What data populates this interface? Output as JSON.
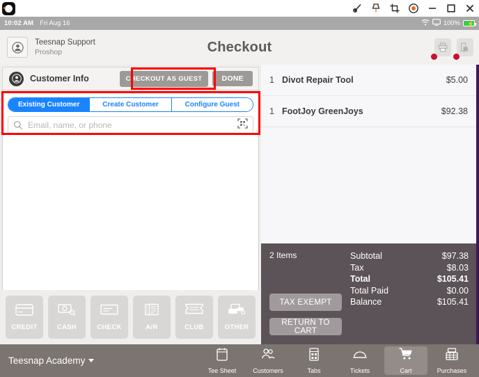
{
  "window": {
    "app_icon": "camera-app-icon",
    "tools": [
      {
        "name": "brush-icon",
        "label": "Brush"
      },
      {
        "name": "pin-icon",
        "label": "Pin"
      },
      {
        "name": "crop-icon",
        "label": "Crop"
      },
      {
        "name": "record-icon",
        "label": "Record"
      },
      {
        "name": "minimize-icon",
        "label": "Minimize"
      },
      {
        "name": "maximize-icon",
        "label": "Maximize"
      },
      {
        "name": "close-icon",
        "label": "Close"
      }
    ]
  },
  "statusbar": {
    "time": "10:02 AM",
    "date": "Fri Aug 16",
    "wifi_icon": "wifi-icon",
    "airplay_icon": "display-icon",
    "battery_percent": "100%",
    "battery_color": "#35cd4b"
  },
  "header": {
    "user_name": "Teesnap Support",
    "user_role": "Proshop",
    "title": "Checkout",
    "actions": [
      {
        "name": "printer-button",
        "icon": "printer-icon",
        "badge": true
      },
      {
        "name": "cash-drawer-button",
        "icon": "cash-drawer-icon",
        "badge": true
      }
    ],
    "badge_color": "#c9102c"
  },
  "customer_info": {
    "title": "Customer Info",
    "avatar_icon": "person-circle-icon",
    "checkout_as_guest_label": "CHECKOUT AS GUEST",
    "done_label": "DONE",
    "tabs": [
      {
        "label": "Existing Customer",
        "active": true
      },
      {
        "label": "Create Customer",
        "active": false
      },
      {
        "label": "Configure Guest",
        "active": false
      }
    ],
    "accent_color": "#1a84ff",
    "search": {
      "placeholder": "Email, name, or phone",
      "value": "",
      "left_icon": "search-icon",
      "right_icon": "qr-scan-icon"
    }
  },
  "annotations": {
    "color": "#fe0000",
    "boxes": [
      {
        "name": "annotation-checkout-as-guest"
      },
      {
        "name": "annotation-customer-search"
      }
    ]
  },
  "payment_methods": [
    {
      "label": "CREDIT",
      "icon": "credit-card-icon"
    },
    {
      "label": "CASH",
      "icon": "cash-icon"
    },
    {
      "label": "CHECK",
      "icon": "check-icon"
    },
    {
      "label": "A/R",
      "icon": "receipt-icon"
    },
    {
      "label": "CLUB",
      "icon": "club-ticket-icon"
    },
    {
      "label": "OTHER",
      "icon": "other-icon"
    }
  ],
  "cart": {
    "items": [
      {
        "qty": "1",
        "name": "Divot Repair Tool",
        "price": "$5.00"
      },
      {
        "qty": "1",
        "name": "FootJoy GreenJoys",
        "price": "$92.38"
      }
    ],
    "items_count_label": "2 Items",
    "totals": [
      {
        "label": "Subtotal",
        "value": "$97.38",
        "bold": false
      },
      {
        "label": "Tax",
        "value": "$8.03",
        "bold": false
      },
      {
        "label": "Total",
        "value": "$105.41",
        "bold": true
      },
      {
        "label": "Total Paid",
        "value": "$0.00",
        "bold": false
      },
      {
        "label": "Balance",
        "value": "$105.41",
        "bold": false
      }
    ],
    "tax_exempt_label": "TAX EXEMPT",
    "return_to_cart_label": "RETURN TO CART"
  },
  "bottom_nav": {
    "account_label": "Teesnap Academy",
    "items": [
      {
        "label": "Tee Sheet",
        "icon": "tee-sheet-icon",
        "active": false
      },
      {
        "label": "Customers",
        "icon": "customers-icon",
        "active": false
      },
      {
        "label": "Tabs",
        "icon": "tabs-icon",
        "active": false
      },
      {
        "label": "Tickets",
        "icon": "tickets-icon",
        "active": false
      },
      {
        "label": "Cart",
        "icon": "cart-icon",
        "active": true
      },
      {
        "label": "Purchases",
        "icon": "purchases-icon",
        "active": false
      }
    ]
  }
}
